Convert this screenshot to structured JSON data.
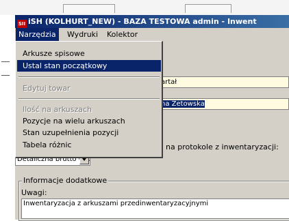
{
  "window": {
    "icon_text": "SII",
    "title": "iSH (KOLHURT_NEW) - BAZA TESTOWA  admin - Inwent"
  },
  "menubar": {
    "items": [
      {
        "label": "Narzędzia",
        "active": true
      },
      {
        "label": "Wydruki",
        "active": false
      },
      {
        "label": "Kolektor",
        "active": false
      }
    ]
  },
  "dropdown": {
    "items": [
      {
        "label": "Arkusze spisowe",
        "state": "normal"
      },
      {
        "label": "Ustal stan początkowy",
        "state": "highlighted"
      },
      {
        "label": "Edytuj towar",
        "state": "disabled"
      },
      {
        "label": "Ilość na arkuszach",
        "state": "disabled"
      },
      {
        "label": "Pozycje na wielu arkuszach",
        "state": "normal"
      },
      {
        "label": "Stan uzupełnienia pozycji",
        "state": "normal"
      },
      {
        "label": "Tabela różnic",
        "state": "normal"
      }
    ]
  },
  "form": {
    "field1_value": "artał",
    "field2_value": "na Zetowska",
    "protocol_label": "na protokole z inwentaryzacji:",
    "price_combo_value": "Detaliczna brutto Grodzi"
  },
  "info": {
    "group_title": "Informacje dodatkowe",
    "notes_label": "Uwagi:",
    "notes_value": "Inwentaryzacja z arkuszami przedinwentaryzacyjnymi"
  },
  "colors": {
    "titlebar": "#0a246a",
    "highlight": "#0a246a",
    "face": "#d4d0c8",
    "input_yellow": "#fffbe0"
  }
}
